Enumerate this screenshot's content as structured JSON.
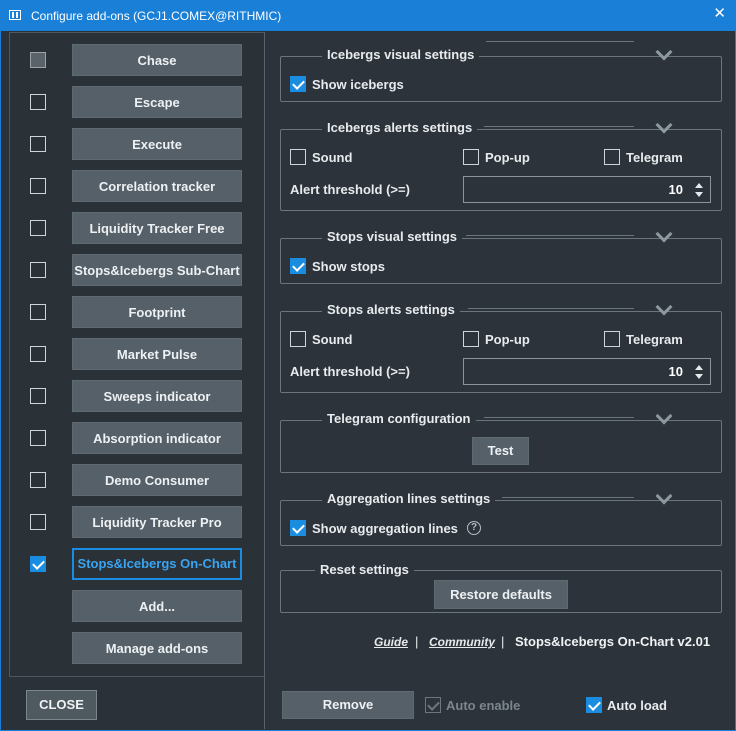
{
  "window": {
    "title": "Configure add-ons (GCJ1.COMEX@RITHMIC)"
  },
  "addons": [
    {
      "label": "Chase",
      "state": "disabled"
    },
    {
      "label": "Escape",
      "state": "unchecked"
    },
    {
      "label": "Execute",
      "state": "unchecked"
    },
    {
      "label": "Correlation tracker",
      "state": "unchecked"
    },
    {
      "label": "Liquidity Tracker Free",
      "state": "unchecked"
    },
    {
      "label": "Stops&Icebergs Sub-Chart",
      "state": "unchecked"
    },
    {
      "label": "Footprint",
      "state": "unchecked"
    },
    {
      "label": "Market Pulse",
      "state": "unchecked"
    },
    {
      "label": "Sweeps indicator",
      "state": "unchecked"
    },
    {
      "label": "Absorption indicator",
      "state": "unchecked"
    },
    {
      "label": "Demo Consumer",
      "state": "unchecked"
    },
    {
      "label": "Liquidity Tracker Pro",
      "state": "unchecked"
    },
    {
      "label": "Stops&Icebergs On-Chart",
      "state": "checked"
    }
  ],
  "left": {
    "add_label": "Add...",
    "manage_label": "Manage add-ons",
    "close_label": "CLOSE"
  },
  "icebergs_visual": {
    "title": "Icebergs visual settings",
    "show_label": "Show icebergs"
  },
  "icebergs_alerts": {
    "title": "Icebergs alerts settings",
    "sound": "Sound",
    "popup": "Pop-up",
    "telegram": "Telegram",
    "threshold_label": "Alert threshold (>=)",
    "threshold_value": "10"
  },
  "stops_visual": {
    "title": "Stops visual settings",
    "show_label": "Show stops"
  },
  "stops_alerts": {
    "title": "Stops alerts settings",
    "sound": "Sound",
    "popup": "Pop-up",
    "telegram": "Telegram",
    "threshold_label": "Alert threshold (>=)",
    "threshold_value": "10"
  },
  "telegram": {
    "title": "Telegram configuration",
    "test_label": "Test"
  },
  "aggregation": {
    "title": "Aggregation lines settings",
    "show_label": "Show aggregation lines",
    "help_icon": "?"
  },
  "reset": {
    "title": "Reset settings",
    "restore_label": "Restore defaults"
  },
  "footer": {
    "guide": "Guide",
    "community": "Community",
    "separator": "|",
    "version": "Stops&Icebergs On-Chart v2.01"
  },
  "bottom": {
    "remove_label": "Remove",
    "auto_enable_label": "Auto enable",
    "auto_load_label": "Auto load"
  },
  "colors": {
    "accent": "#1a8de0",
    "titlebar": "#1a7fd6",
    "background": "#2b3138",
    "button": "#556068"
  }
}
